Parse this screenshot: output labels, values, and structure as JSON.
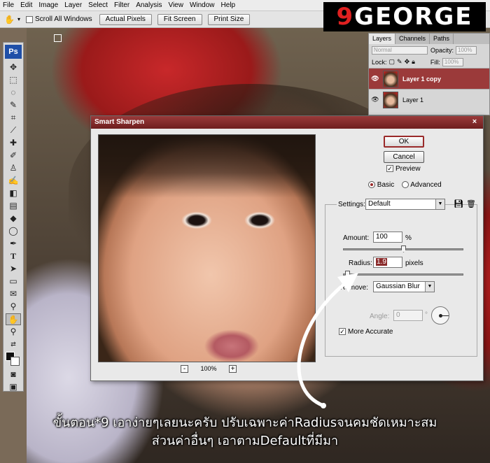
{
  "menu": {
    "items": [
      "File",
      "Edit",
      "Image",
      "Layer",
      "Select",
      "Filter",
      "Analysis",
      "View",
      "Window",
      "Help"
    ]
  },
  "options_bar": {
    "scroll_all_label": "Scroll All Windows",
    "actual_pixels": "Actual Pixels",
    "fit_screen": "Fit Screen",
    "print_size": "Print Size"
  },
  "logo": {
    "first": "9",
    "rest": "GEORGE"
  },
  "toolbox": {
    "ps_label": "Ps"
  },
  "layers_panel": {
    "tabs": [
      "Layers",
      "Channels",
      "Paths"
    ],
    "blend_mode": "Normal",
    "opacity_label": "Opacity:",
    "opacity_value": "100%",
    "lock_label": "Lock:",
    "fill_label": "Fill:",
    "fill_value": "100%",
    "layers": [
      {
        "name": "Layer 1 copy",
        "selected": true
      },
      {
        "name": "Layer 1",
        "selected": false
      }
    ]
  },
  "dialog": {
    "title": "Smart Sharpen",
    "close_glyph": "×",
    "ok_label": "OK",
    "cancel_label": "Cancel",
    "preview_label": "Preview",
    "basic_label": "Basic",
    "advanced_label": "Advanced",
    "settings_label": "Settings:",
    "settings_value": "Default",
    "amount_label": "Amount:",
    "amount_value": "100",
    "amount_unit": "%",
    "amount_slider": 0.5,
    "radius_label": "Radius:",
    "radius_value": "1.9",
    "radius_unit": "pixels",
    "radius_slider": 0.03,
    "remove_label": "Remove:",
    "remove_value": "Gaussian Blur",
    "angle_label": "Angle:",
    "angle_value": "0",
    "angle_unit": "°",
    "more_accurate_label": "More Accurate",
    "zoom_value": "100%",
    "zoom_out": "-",
    "zoom_in": "+"
  },
  "caption": {
    "line1": "ขั้นตอน*9  เอาง่ายๆเลยนะครับ  ปรับเฉพาะค่าRadiusจนคมชัดเหมาะสม",
    "line2": "ส่วนค่าอื่นๆ  เอาตามDefaultที่มีมา"
  },
  "colors": {
    "dialog_title": "#7a2424",
    "selected_layer": "#9b3a3a",
    "caption_text": "#ffffff"
  }
}
